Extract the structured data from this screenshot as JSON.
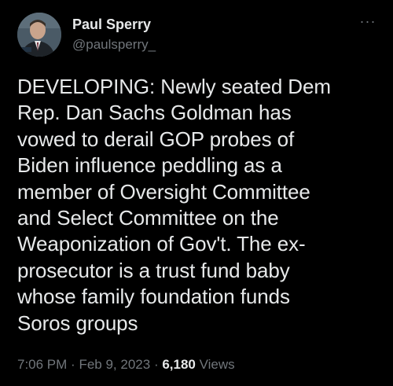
{
  "author": {
    "display_name": "Paul Sperry",
    "handle": "@paulsperry_"
  },
  "more_icon": "ellipsis-icon",
  "tweet": {
    "text_lines": [
      "DEVELOPING: Newly seated Dem",
      "Rep. Dan Sachs Goldman has",
      "vowed to derail GOP probes of",
      "Biden influence peddling as a",
      "member of Oversight Committee",
      "and Select Committee on the",
      "Weaponization of Gov't. The ex-",
      "prosecutor is a trust fund baby",
      "whose family foundation funds",
      "Soros groups"
    ]
  },
  "meta": {
    "time": "7:06 PM",
    "separator": "·",
    "date": "Feb 9, 2023",
    "views_count": "6,180",
    "views_label": "Views"
  },
  "colors": {
    "background": "#000000",
    "text": "#e7e9ea",
    "secondary": "#71767b"
  }
}
